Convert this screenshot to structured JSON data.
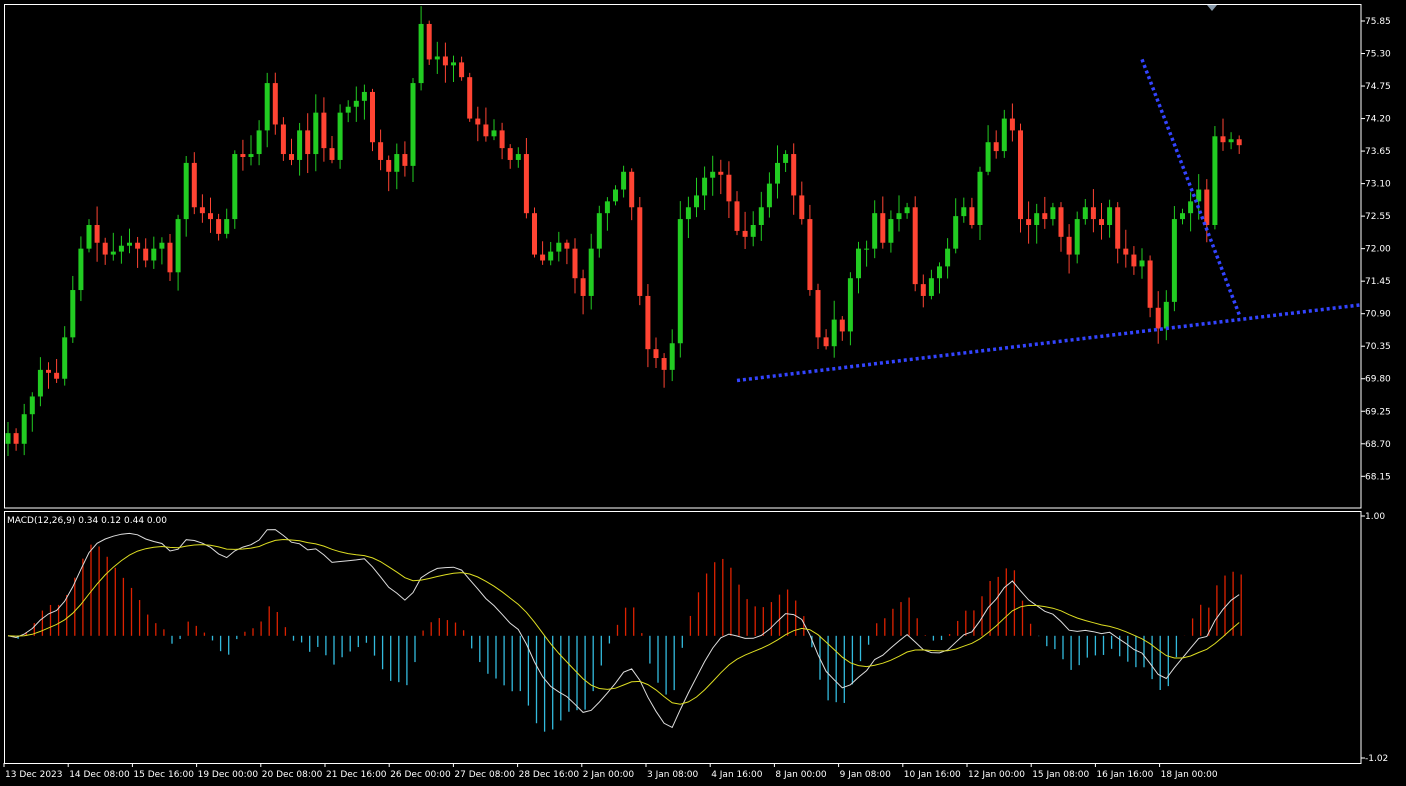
{
  "colors": {
    "background": "#000000",
    "frame": "#ffffff",
    "bull": "#22cc22",
    "bear": "#ff4433",
    "trendline": "#3344ff",
    "hist_pos": "#dd2200",
    "hist_neg": "#33bbdd",
    "macd_line": "#dddddd",
    "signal_line": "#dddd22",
    "text": "#ffffff"
  },
  "chart_data": [
    {
      "type": "candlestick",
      "ylim": [
        67.7,
        76.1
      ],
      "grid": false,
      "y_ticks": [
        "75.85",
        "75.30",
        "74.75",
        "74.20",
        "73.65",
        "73.10",
        "72.55",
        "72.00",
        "71.45",
        "70.90",
        "70.35",
        "69.80",
        "69.25",
        "68.70",
        "68.15"
      ],
      "x_ticks": [
        "13 Dec 2023",
        "14 Dec 08:00",
        "15 Dec 16:00",
        "19 Dec 00:00",
        "20 Dec 08:00",
        "21 Dec 16:00",
        "26 Dec 00:00",
        "27 Dec 08:00",
        "28 Dec 16:00",
        "2 Jan 00:00",
        "3 Jan 08:00",
        "4 Jan 16:00",
        "8 Jan 00:00",
        "9 Jan 08:00",
        "10 Jan 16:00",
        "12 Jan 00:00",
        "15 Jan 08:00",
        "16 Jan 16:00",
        "18 Jan 00:00"
      ],
      "closes": [
        68.88,
        68.7,
        69.2,
        69.5,
        69.95,
        69.9,
        69.8,
        70.5,
        71.3,
        72.0,
        72.4,
        72.1,
        71.9,
        71.95,
        72.05,
        72.1,
        72.0,
        71.8,
        72.0,
        72.1,
        71.6,
        72.5,
        73.45,
        72.7,
        72.6,
        72.5,
        72.25,
        72.5,
        73.6,
        73.55,
        73.6,
        74.0,
        74.8,
        74.1,
        73.6,
        73.5,
        74.0,
        73.6,
        74.3,
        73.7,
        73.5,
        74.3,
        74.4,
        74.5,
        74.65,
        73.8,
        73.5,
        73.3,
        73.6,
        73.4,
        74.8,
        75.8,
        75.2,
        75.25,
        75.1,
        75.15,
        74.9,
        74.2,
        74.1,
        73.9,
        74.0,
        73.7,
        73.5,
        73.6,
        72.6,
        71.9,
        71.8,
        71.95,
        72.1,
        72.0,
        71.5,
        71.2,
        72.0,
        72.6,
        72.8,
        73.0,
        73.3,
        72.7,
        71.2,
        70.3,
        70.15,
        69.95,
        70.4,
        72.5,
        72.7,
        72.9,
        73.2,
        73.3,
        73.25,
        72.8,
        72.3,
        72.2,
        72.4,
        72.7,
        73.1,
        73.45,
        73.6,
        72.9,
        72.5,
        71.3,
        70.5,
        70.35,
        70.8,
        70.6,
        71.5,
        72.0,
        72.0,
        72.6,
        72.1,
        72.5,
        72.6,
        72.7,
        71.4,
        71.2,
        71.5,
        71.7,
        72.0,
        72.55,
        72.7,
        72.4,
        73.3,
        73.8,
        73.65,
        74.2,
        74.0,
        72.5,
        72.4,
        72.6,
        72.5,
        72.7,
        72.2,
        71.9,
        72.5,
        72.7,
        72.5,
        72.4,
        72.7,
        72.0,
        71.9,
        71.7,
        71.8,
        71.0,
        70.65,
        71.1,
        72.5,
        72.6,
        72.8,
        73.0,
        72.4,
        73.9,
        73.8,
        73.85,
        73.75
      ],
      "trendlines": [
        {
          "start_index": 90,
          "start_price": 69.77,
          "end_price": 71.05,
          "style": "dotted"
        },
        {
          "start_index": 140,
          "start_price": 75.2,
          "end_price": 70.85,
          "style": "dotted"
        }
      ]
    },
    {
      "type": "macd",
      "label": "MACD(12,26,9) 0.34 0.12 0.44 0.00",
      "ylim": [
        -1.02,
        1.0
      ],
      "y_ticks": [
        "1.00",
        "-1.02"
      ],
      "zero_level": 0.0
    }
  ]
}
